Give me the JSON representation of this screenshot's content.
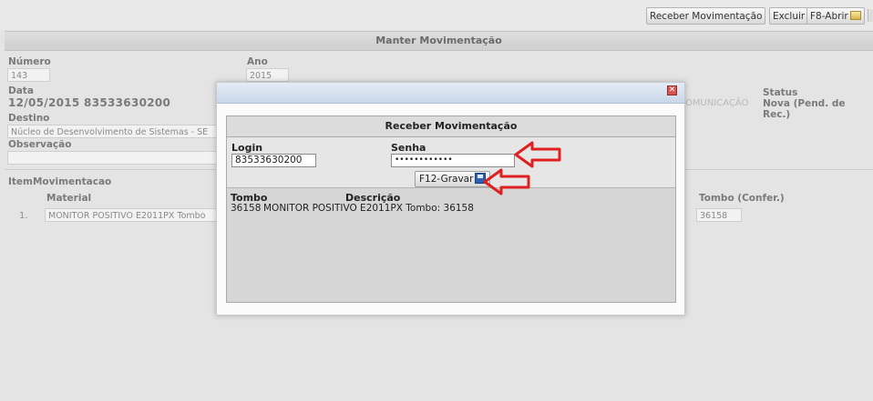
{
  "toolbar": {
    "receber_label": "Receber Movimentação",
    "excluir_label": "Excluir",
    "abrir_label": "F8-Abrir"
  },
  "page": {
    "title": "Manter Movimentação"
  },
  "form": {
    "numero_label": "Número",
    "numero_value": "143",
    "ano_label": "Ano",
    "ano_value": "2015",
    "data_label": "Data",
    "data_value": "12/05/2015  83533630200",
    "destino_label": "Destino",
    "destino_value": "Núcleo de Desenvolvimento de Sistemas - SE",
    "observacao_label": "Observação",
    "observacao_value": "",
    "comunicacao_partial": "OMUNICAÇÃO",
    "status_label": "Status",
    "status_value": "Nova (Pend. de Rec.)"
  },
  "items": {
    "section_title": "ItemMovimentacao",
    "material_label": "Material",
    "tombo_confer_label": "Tombo (Confer.)",
    "rows": [
      {
        "index": "1.",
        "material": "MONITOR POSITIVO E2011PX Tombo",
        "tombo_confer": "36158"
      }
    ]
  },
  "dialog": {
    "header": "Receber Movimentação",
    "close_symbol": "✕",
    "login_label": "Login",
    "login_value": "83533630200",
    "senha_label": "Senha",
    "senha_value": "••••••••••••",
    "gravar_label": "F12-Gravar",
    "table_headers": {
      "tombo": "Tombo",
      "descricao": "Descrição"
    },
    "table_row": {
      "tombo": "36158",
      "descricao": "MONITOR POSITIVO E2011PX Tombo: 36158"
    }
  },
  "colors": {
    "annotation_arrow": "#e02020"
  }
}
